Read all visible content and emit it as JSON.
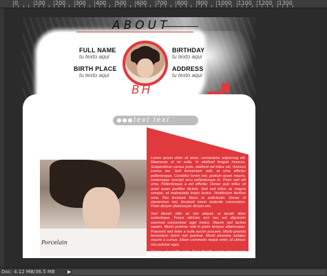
{
  "ruler": {
    "labels": [
      "200",
      "100",
      "0",
      "100",
      "200",
      "300",
      "400",
      "500",
      "600",
      "700",
      "800",
      "900",
      "1000",
      "1100",
      "1200",
      "1300"
    ]
  },
  "canvas": {
    "about_title": "ABOUT",
    "fields": {
      "full_name_label": "FULL NAME",
      "full_name_value": "tu texto aqui",
      "birthday_label": "BIRTHDAY",
      "birthday_value": "tu texto aqui",
      "birth_place_label": "BIRTH PLACE",
      "birth_place_value": "tu texto aqui",
      "address_label": "ADDRESS",
      "address_value": "tu texto aqui"
    },
    "initials": "BH",
    "pill_text": "text text",
    "photo_brand": "Porcelain",
    "lorem_paragraphs": [
      "Lorem ipsum dolor sit amet, consectetur adipiscing elit. Maecenas ut mi nulla. In eleifend feugiat rhoncus. Suspendisse cursus justo, eleifend vel tellus vel, rhoncus cursus leo. Sed fermentum velit, ut urna efficitur pellentesque. Curabitur lorem nisi, pretium quam mauris, scelerisque suscipit arcu pellentesque in. Proin sed elit urna. Pellentesque a est efficitur. Donec quis tellus sit amet quam porttitor dictum. Sed sed tellus ac magna semper, et malesuada turpis luctus. Vestibulum facilisis urna. Nisi tincidunt libero ut sollicitudin. Donec id elementum nisi, tincidunt lorem molestie consectetur. Proin dictum ullamcorper dictum nec.",
      "Sed dictum nibh ac nisi aliquet, ut iaculis diam scelerisque. Fusce ultricies orci nec est dignissim euismod consectetur eget metus. Mauris sed lacinia sapien. Morbi pulvinar velit in porta tempus ullamcorper. Praesent sed dolor a nulla auctor posuere. Morbi gravida fermentum lorem non pulvinar. Morbi pharetra sodales mauris a cursus. Etiam commodo neque enim, id ultrices nisl pulvinar eget.",
      "Donec vel sagittis enim. Nam fringilla quam sed posuere iaculis. Donec rutrum elementum enim, vitae sollicitudin lorem accumsan vel. Aenean luctus mauris ac dignissim. Duis urna arcu."
    ]
  },
  "status_bar": {
    "doc_info": "Doc: 4.12 MB/36.5 MB",
    "arrow": "▶"
  },
  "colors": {
    "accent": "#e0393e",
    "workspace": "#2b2b2b",
    "canvas": "#ffffff"
  }
}
